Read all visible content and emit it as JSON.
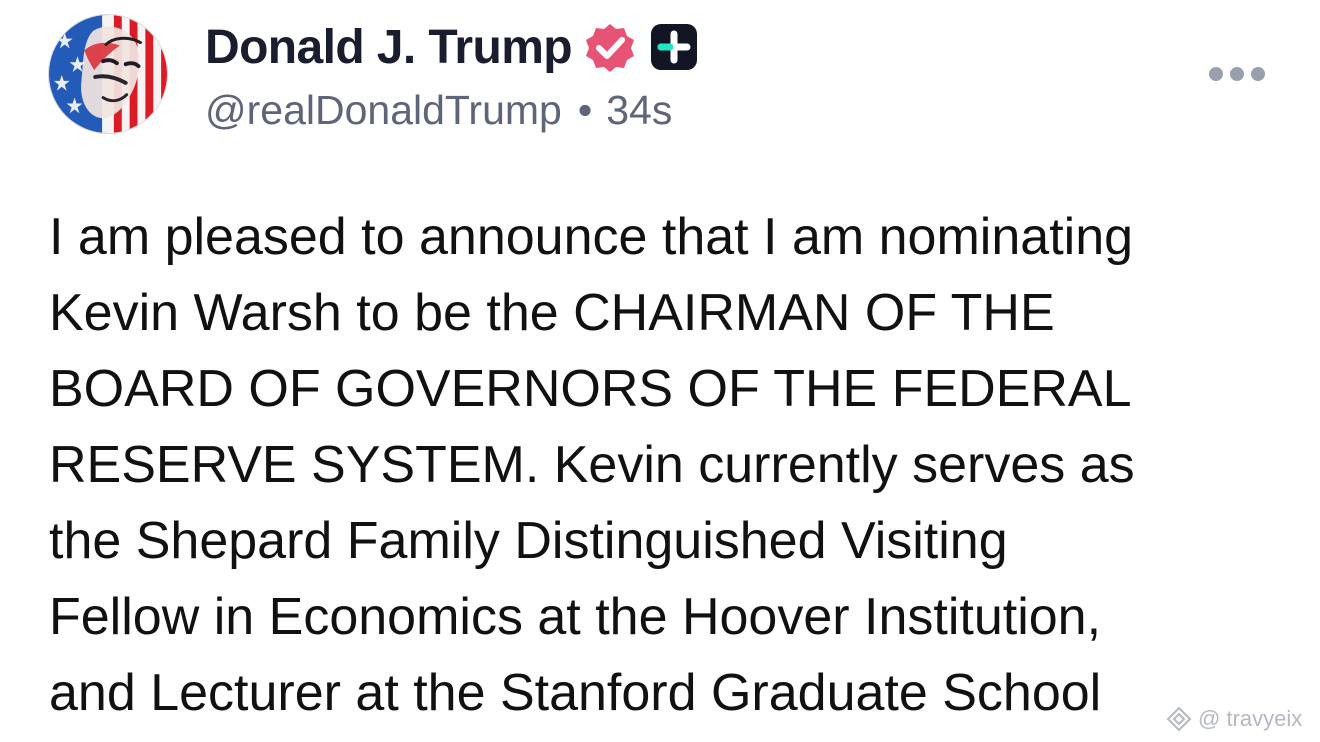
{
  "post": {
    "author": {
      "display_name": "Donald J. Trump",
      "handle": "@realDonaldTrump",
      "separator": "•",
      "time_ago": "34s",
      "avatar_icon": "flag-portrait-avatar",
      "verified_icon": "verified-badge-icon",
      "plus_icon": "plus-badge-icon"
    },
    "menu_icon": "more-icon",
    "body_lines": [
      "I am pleased to announce that I am nominating",
      "Kevin Warsh to be the CHAIRMAN OF THE",
      "BOARD OF GOVERNORS OF THE FEDERAL",
      "RESERVE SYSTEM. Kevin currently serves as",
      "the Shepard Family Distinguished Visiting",
      "Fellow in Economics at the Hoover Institution,",
      "and Lecturer at the Stanford Graduate School"
    ]
  },
  "watermark": {
    "text": "@ travyeix",
    "icon": "watermark-logo-icon"
  },
  "colors": {
    "verified": "#e75374",
    "plus_badge": "#121624",
    "plus_accent": "#1ee7c5",
    "handle": "#5f6578",
    "name": "#1a1d2e",
    "body": "#111111",
    "menu_dots": "#9aa0ab"
  }
}
